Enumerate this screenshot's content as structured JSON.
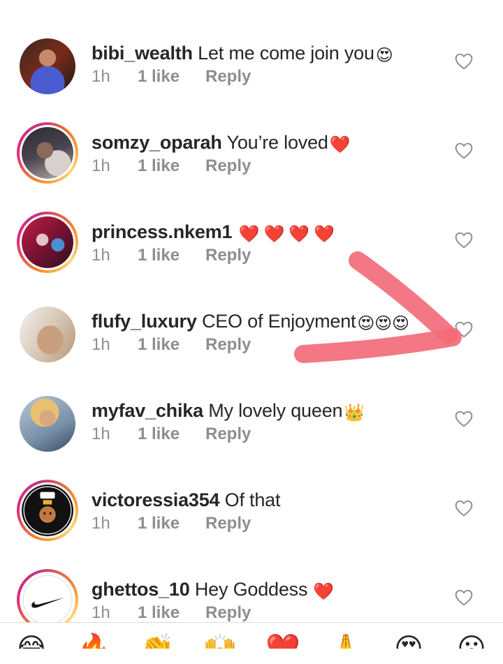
{
  "comments": [
    {
      "username": "bibi_wealth",
      "text": "Let me come join you",
      "emoji": "😍",
      "time": "1h",
      "likes": "1 like",
      "reply": "Reply"
    },
    {
      "username": "somzy_oparah",
      "text": "You’re loved",
      "emoji": "❤️",
      "time": "1h",
      "likes": "1 like",
      "reply": "Reply"
    },
    {
      "username": "princess.nkem1",
      "text": "",
      "emoji": "❤️❤️❤️❤️",
      "time": "1h",
      "likes": "1 like",
      "reply": "Reply"
    },
    {
      "username": "flufy_luxury",
      "text": "CEO of Enjoyment",
      "emoji": "😍😍😍",
      "time": "1h",
      "likes": "1 like",
      "reply": "Reply"
    },
    {
      "username": "myfav_chika",
      "text": "My lovely queen",
      "emoji": "👑",
      "time": "1h",
      "likes": "1 like",
      "reply": "Reply"
    },
    {
      "username": "victoressia354",
      "text": "Of that",
      "emoji": "",
      "time": "1h",
      "likes": "1 like",
      "reply": "Reply"
    },
    {
      "username": "ghettos_10",
      "text": "Hey Goddess",
      "emoji": "❤️",
      "time": "1h",
      "likes": "1 like",
      "reply": "Reply"
    }
  ],
  "quick_reactions": [
    "😂",
    "🔥",
    "👏",
    "🙌",
    "❤️",
    "🙏",
    "😍",
    "😮"
  ],
  "colors": {
    "text": "#262626",
    "meta": "#8e8e8e",
    "heart_emoji": "#e0457b",
    "arrow": "#f26b7a",
    "story_ring": [
      "#f58529",
      "#dd2a7b",
      "#feda77"
    ]
  },
  "icons": {
    "like_button": "heart-outline-icon",
    "annotation": "red-arrow-icon"
  }
}
